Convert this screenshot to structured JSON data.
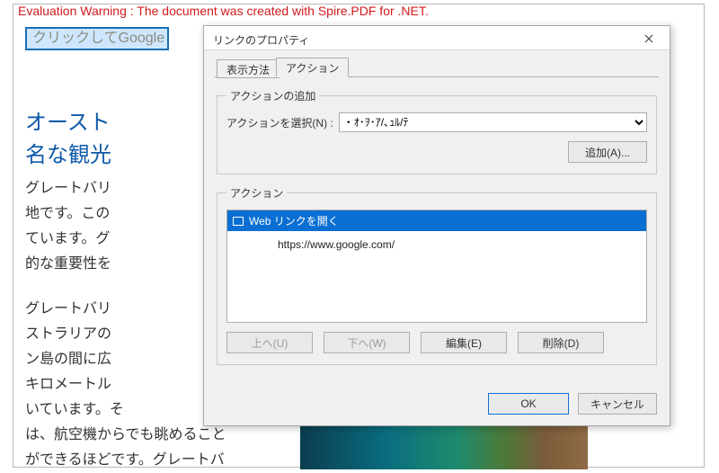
{
  "doc": {
    "warning": "Evaluation Warning : The document was created with Spire.PDF for .NET.",
    "link_button": "クリックしてGoogle",
    "title_line1": "オースト",
    "title_line2": "名な観光",
    "para1": "グレートバリ\n地です。この\nています。グ\n的な重要性を",
    "para2": "グレートバリ\nストラリアの\nン島の間に広\nキロメートル\nいています。そ\nは、航空機からでも眺めること\nができるほどです。グレートバ"
  },
  "dialog": {
    "title": "リンクのプロパティ",
    "tabs": {
      "display": "表示方法",
      "action": "アクション"
    },
    "add_group": {
      "legend": "アクションの追加",
      "select_label": "アクションを選択(N) :",
      "select_value": "・ｵ･ｦ･ｱ/､ｭﾙ/ﾃ",
      "add_button": "追加(A)..."
    },
    "actions_group": {
      "legend": "アクション",
      "item_title": "Web リンクを開く",
      "item_url": "https://www.google.com/",
      "up": "上へ(U)",
      "down": "下へ(W)",
      "edit": "編集(E)",
      "delete": "削除(D)"
    },
    "footer": {
      "ok": "OK",
      "cancel": "キャンセル"
    }
  }
}
